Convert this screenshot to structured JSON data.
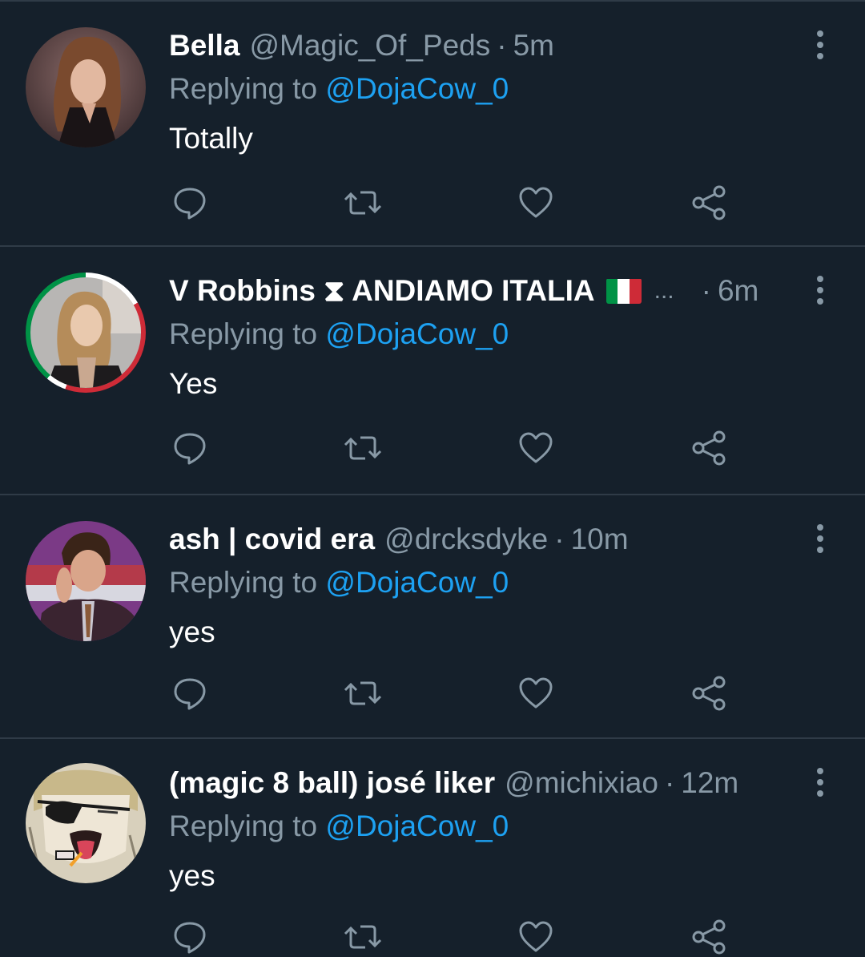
{
  "colors": {
    "background": "#15202b",
    "divider": "#2f3b47",
    "secondary_text": "#8899a6",
    "link": "#1da1f2",
    "primary_text": "#ffffff"
  },
  "tweets": [
    {
      "name": "Bella",
      "handle": "@Magic_Of_Peds",
      "separator": "·",
      "time": "5m",
      "replying_prefix": "Replying to",
      "mention": "@DojaCow_0",
      "text": "Totally",
      "avatar_icon": "avatar-photo"
    },
    {
      "name": "V Robbins ⧗ ANDIAMO ITALIA",
      "name_suffix_icon": "italy-flag-icon",
      "name_truncation": "...",
      "handle": "",
      "separator": "·",
      "time": "6m",
      "replying_prefix": "Replying to",
      "mention": "@DojaCow_0",
      "text": "Yes",
      "avatar_icon": "avatar-photo"
    },
    {
      "name": "ash | covid era",
      "handle": "@drcksdyke",
      "separator": "·",
      "time": "10m",
      "replying_prefix": "Replying to",
      "mention": "@DojaCow_0",
      "text": "yes",
      "avatar_icon": "avatar-photo"
    },
    {
      "name": "(magic 8 ball) josé liker",
      "handle": "@michixiao",
      "separator": "·",
      "time": "12m",
      "replying_prefix": "Replying to",
      "mention": "@DojaCow_0",
      "text": "yes",
      "avatar_icon": "avatar-illustration"
    }
  ],
  "action_icons": [
    "reply-icon",
    "retweet-icon",
    "like-icon",
    "share-icon"
  ],
  "more_icon": "more-vertical-icon"
}
